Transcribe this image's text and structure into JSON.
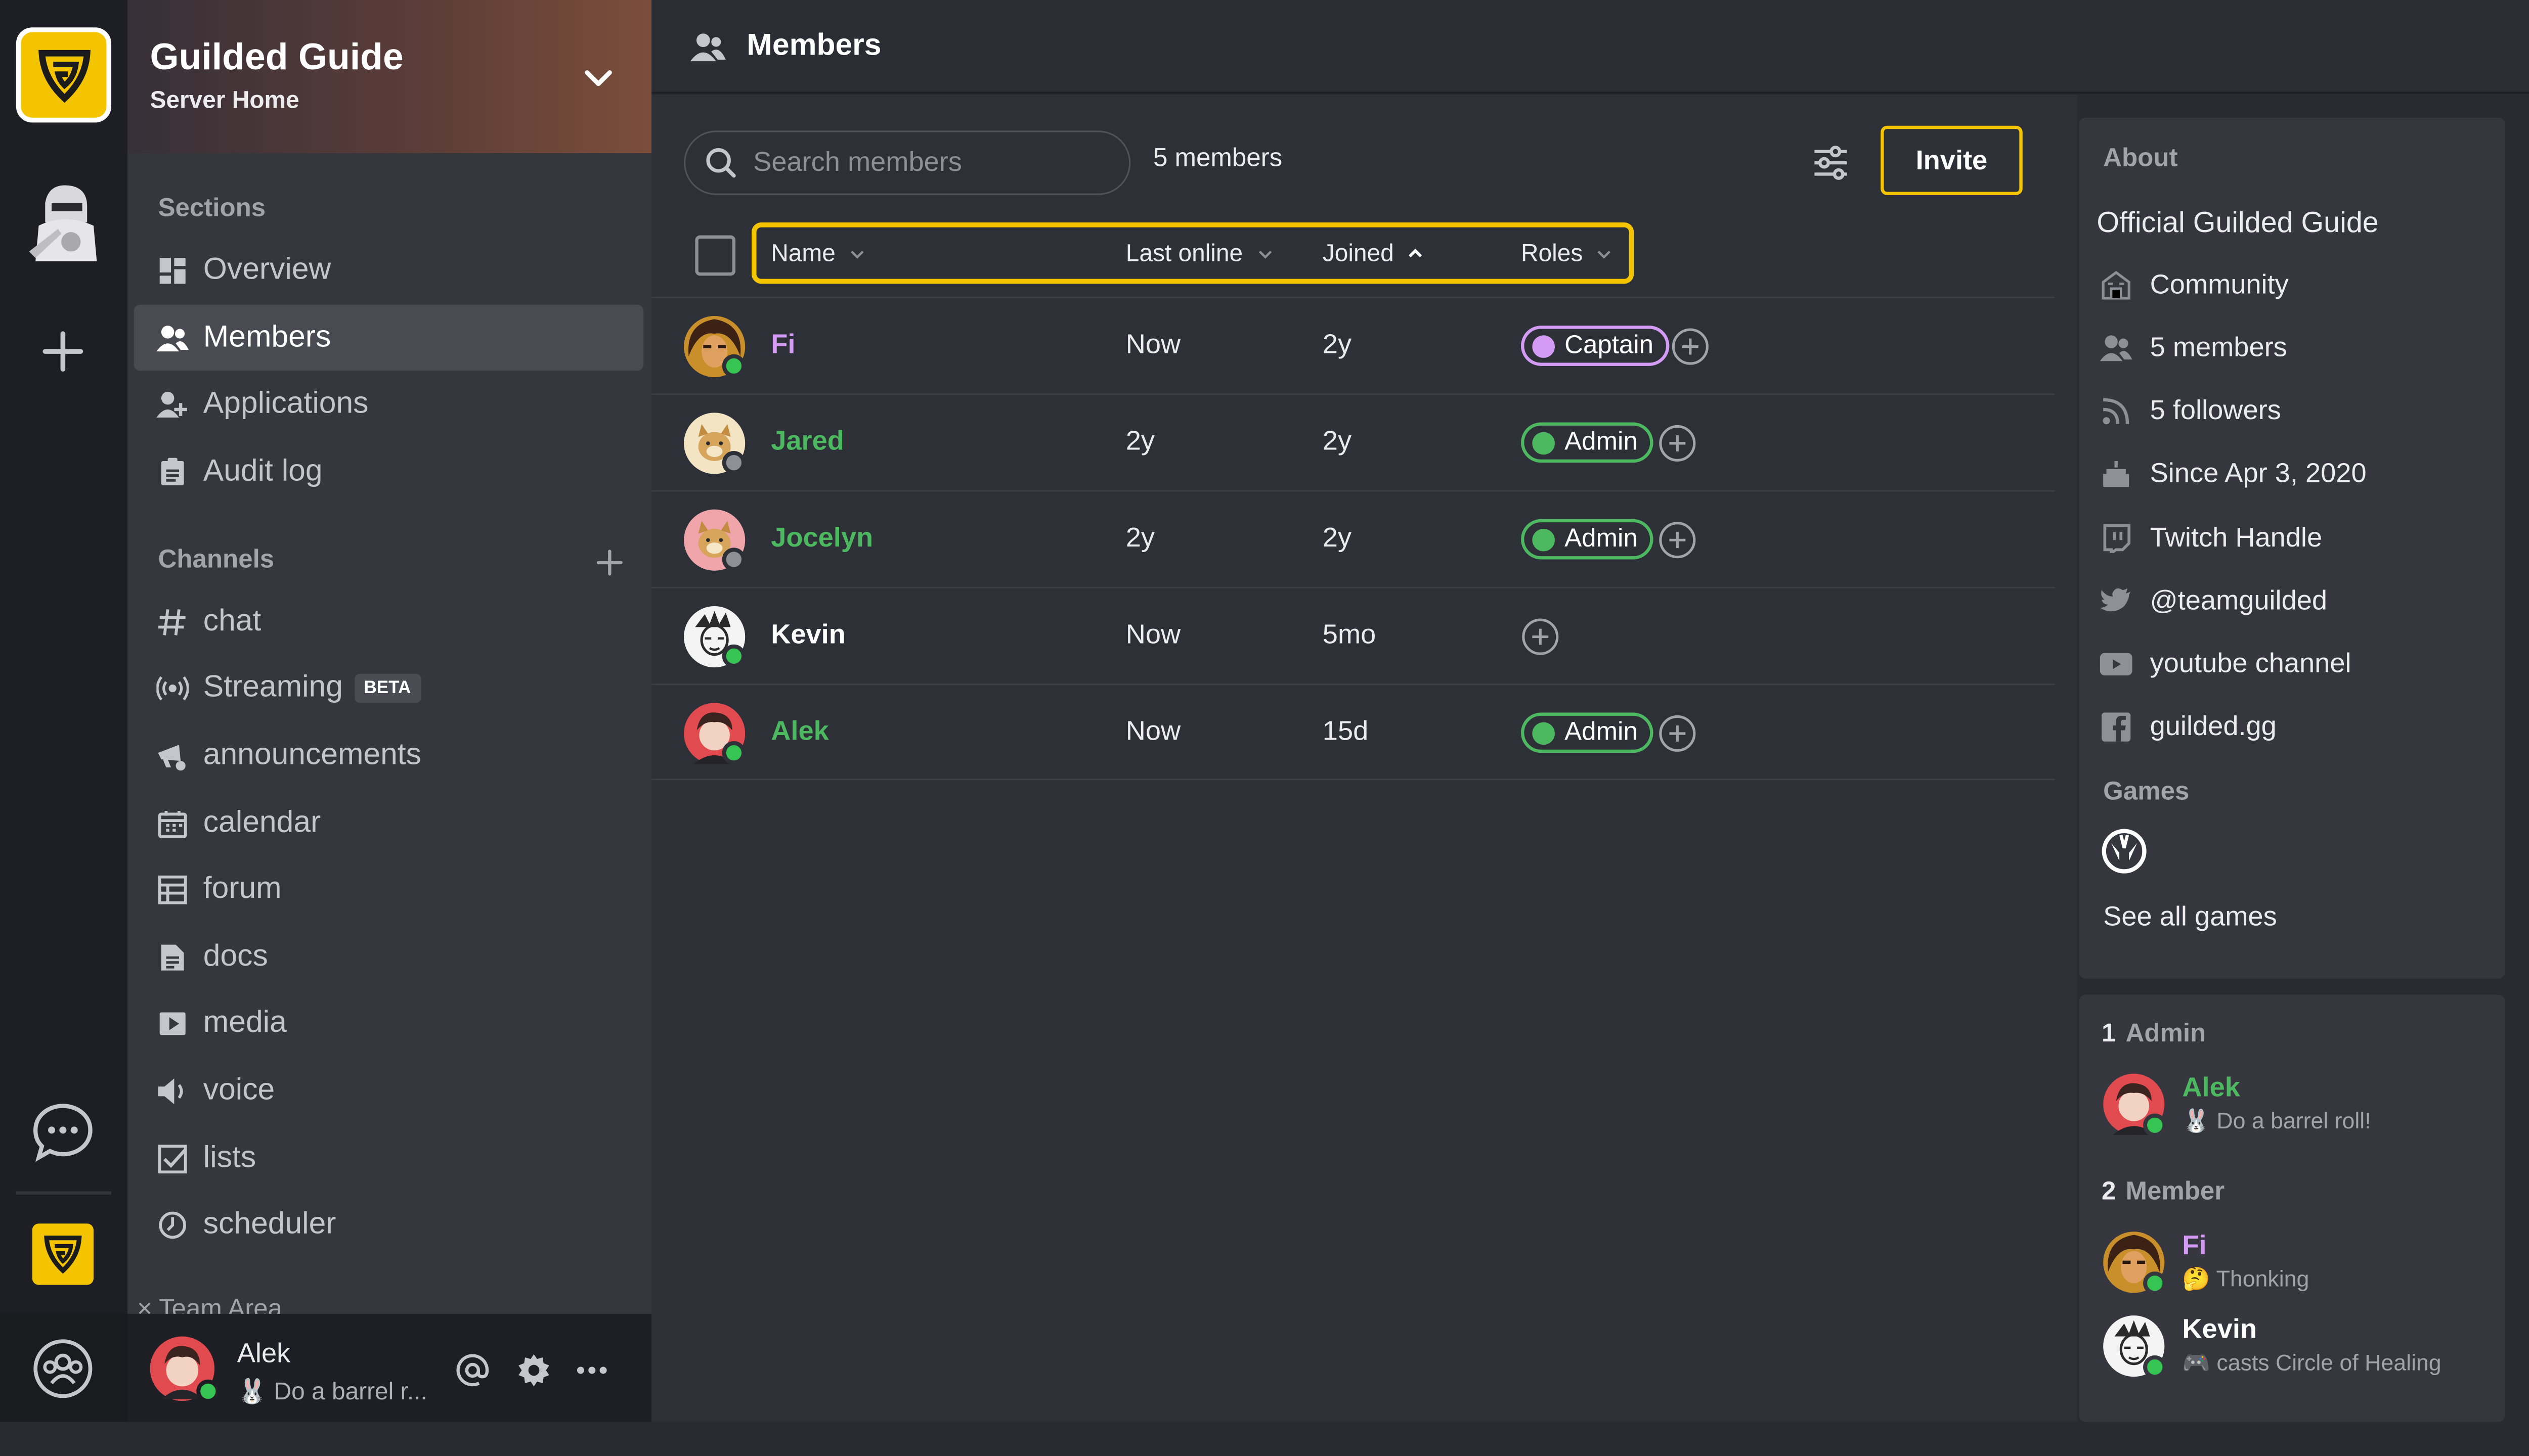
{
  "server": {
    "name": "Guilded Guide",
    "subtitle": "Server Home"
  },
  "sidebar": {
    "sections_title": "Sections",
    "sections": [
      {
        "label": "Overview",
        "icon": "overview-icon"
      },
      {
        "label": "Members",
        "icon": "members-icon",
        "active": true
      },
      {
        "label": "Applications",
        "icon": "applications-icon"
      },
      {
        "label": "Audit log",
        "icon": "audit-log-icon"
      }
    ],
    "channels_title": "Channels",
    "channels": [
      {
        "label": "chat",
        "icon": "hash-icon"
      },
      {
        "label": "Streaming",
        "icon": "streaming-icon",
        "badge": "BETA"
      },
      {
        "label": "announcements",
        "icon": "megaphone-icon"
      },
      {
        "label": "calendar",
        "icon": "calendar-icon"
      },
      {
        "label": "forum",
        "icon": "forum-icon"
      },
      {
        "label": "docs",
        "icon": "docs-icon"
      },
      {
        "label": "media",
        "icon": "media-icon"
      },
      {
        "label": "voice",
        "icon": "voice-icon"
      },
      {
        "label": "lists",
        "icon": "lists-icon"
      },
      {
        "label": "scheduler",
        "icon": "scheduler-icon"
      }
    ],
    "team_area": "Team Area"
  },
  "user": {
    "name": "Alek",
    "status": "Do a barrel r..."
  },
  "topbar": {
    "title": "Members"
  },
  "members_view": {
    "search_placeholder": "Search members",
    "count": "5 members",
    "invite_label": "Invite",
    "columns": {
      "name": "Name",
      "last_online": "Last online",
      "joined": "Joined",
      "roles": "Roles"
    },
    "rows": [
      {
        "name": "Fi",
        "name_color": "#d49bf5",
        "last_online": "Now",
        "joined": "2y",
        "role": "Captain",
        "role_color": "#d49bf5",
        "presence": "online"
      },
      {
        "name": "Jared",
        "name_color": "#4cb860",
        "last_online": "2y",
        "joined": "2y",
        "role": "Admin",
        "role_color": "#4cb860",
        "presence": "offline"
      },
      {
        "name": "Jocelyn",
        "name_color": "#4cb860",
        "last_online": "2y",
        "joined": "2y",
        "role": "Admin",
        "role_color": "#4cb860",
        "presence": "offline"
      },
      {
        "name": "Kevin",
        "name_color": "#ffffff",
        "last_online": "Now",
        "joined": "5mo",
        "role": "",
        "role_color": "",
        "presence": "online"
      },
      {
        "name": "Alek",
        "name_color": "#4cb860",
        "last_online": "Now",
        "joined": "15d",
        "role": "Admin",
        "role_color": "#4cb860",
        "presence": "online"
      }
    ]
  },
  "about": {
    "title": "About",
    "name": "Official Guilded Guide",
    "items": [
      {
        "label": "Community",
        "icon": "community-icon"
      },
      {
        "label": "5 members",
        "icon": "members-icon"
      },
      {
        "label": "5 followers",
        "icon": "rss-icon"
      },
      {
        "label": "Since Apr 3, 2020",
        "icon": "cake-icon"
      },
      {
        "label": "Twitch Handle",
        "icon": "twitch-icon"
      },
      {
        "label": "@teamguilded",
        "icon": "twitter-icon"
      },
      {
        "label": "youtube channel",
        "icon": "youtube-icon"
      },
      {
        "label": "guilded.gg",
        "icon": "facebook-icon"
      }
    ],
    "games_title": "Games",
    "game_icon": "overwatch-icon",
    "see_all_games": "See all games"
  },
  "roster": {
    "groups": [
      {
        "count": "1",
        "label": "Admin",
        "members": [
          {
            "name": "Alek",
            "name_color": "#4cb860",
            "status": "Do a barrel roll!"
          }
        ]
      },
      {
        "count": "2",
        "label": "Member",
        "members": [
          {
            "name": "Fi",
            "name_color": "#d49bf5",
            "status": "Thonking"
          },
          {
            "name": "Kevin",
            "name_color": "#ffffff",
            "status": "casts Circle of Healing"
          }
        ]
      }
    ]
  },
  "colors": {
    "accent": "#f5c400",
    "online": "#36c552",
    "offline": "#8e9097"
  }
}
